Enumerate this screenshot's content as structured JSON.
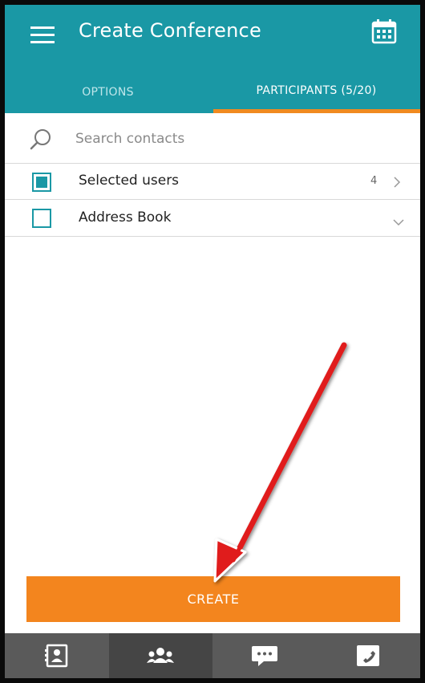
{
  "header": {
    "title": "Create Conference",
    "menu_icon": "hamburger-menu-icon",
    "calendar_icon": "calendar-icon",
    "background_color": "#1a98a5"
  },
  "tabs": [
    {
      "label": "OPTIONS",
      "active": false
    },
    {
      "label": "PARTICIPANTS (5/20)",
      "active": true
    }
  ],
  "tab_indicator_color": "#f08a20",
  "search": {
    "placeholder": "Search contacts",
    "value": "",
    "icon": "search-icon"
  },
  "list": {
    "selected_users": {
      "label": "Selected users",
      "count": "4",
      "checked": true,
      "icon": "chevron-right-icon"
    },
    "address_book": {
      "label": "Address Book",
      "checked": false,
      "icon": "chevron-down-icon"
    }
  },
  "create_button": {
    "label": "CREATE",
    "color": "#f3851e"
  },
  "annotation": {
    "type": "arrow",
    "color": "#e01e1e"
  },
  "bottom_nav": [
    {
      "icon": "contacts-icon",
      "active": false
    },
    {
      "icon": "group-icon",
      "active": true
    },
    {
      "icon": "chat-icon",
      "active": false
    },
    {
      "icon": "phone-icon",
      "active": false
    }
  ]
}
